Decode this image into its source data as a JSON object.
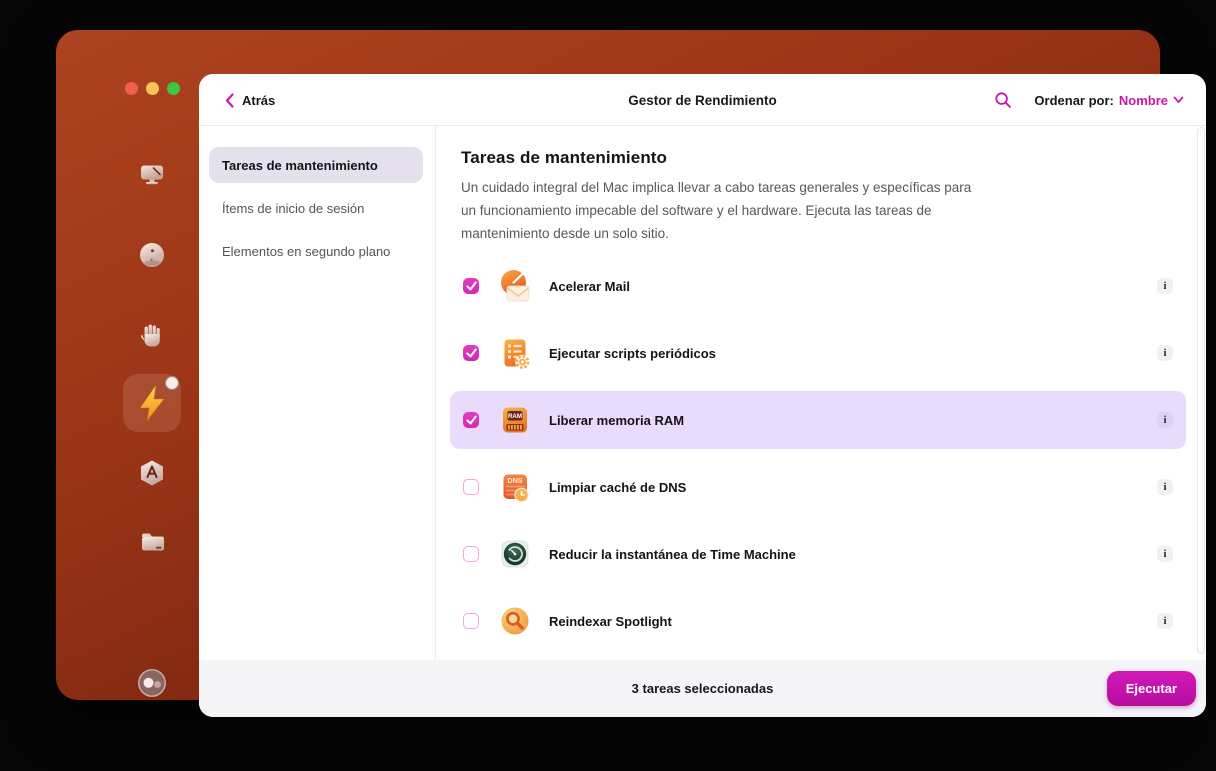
{
  "header": {
    "back_label": "Atrás",
    "title": "Gestor de Rendimiento",
    "sort_label": "Ordenar por:",
    "sort_value": "Nombre"
  },
  "rail": {
    "items": [
      {
        "name": "cleanup-monitor"
      },
      {
        "name": "protection-sphere"
      },
      {
        "name": "privacy-hand"
      },
      {
        "name": "speed-bolt",
        "selected": true,
        "badge": true
      },
      {
        "name": "applications-hexagon"
      },
      {
        "name": "files-folder"
      },
      {
        "name": "assistant"
      }
    ]
  },
  "nav": {
    "items": [
      {
        "label": "Tareas de mantenimiento",
        "selected": true
      },
      {
        "label": "Ítems de inicio de sesión",
        "selected": false
      },
      {
        "label": "Elementos en segundo plano",
        "selected": false
      }
    ]
  },
  "content": {
    "heading": "Tareas de mantenimiento",
    "description": "Un cuidado integral del Mac implica llevar a cabo tareas generales y específicas para un funcionamiento impecable del software y el hardware. Ejecuta las tareas de mantenimiento desde un solo sitio.",
    "info_label": "i",
    "tasks": [
      {
        "label": "Acelerar Mail",
        "checked": true,
        "icon": "mail-speed"
      },
      {
        "label": "Ejecutar scripts periódicos",
        "checked": true,
        "icon": "periodic-scripts"
      },
      {
        "label": "Liberar memoria RAM",
        "checked": true,
        "icon": "ram",
        "highlighted": true
      },
      {
        "label": "Limpiar caché de DNS",
        "checked": false,
        "icon": "dns-cache"
      },
      {
        "label": "Reducir la instantánea de Time Machine",
        "checked": false,
        "icon": "time-machine"
      },
      {
        "label": "Reindexar Spotlight",
        "checked": false,
        "icon": "spotlight"
      }
    ],
    "icon_text": {
      "ram": "RAM",
      "dns": "DNS"
    }
  },
  "footer": {
    "status": "3 tareas seleccionadas",
    "run_label": "Ejecutar"
  },
  "colors": {
    "accent": "#cc16a9",
    "checkbox": "#d429b2",
    "row_highlight": "#e9dbfb",
    "nav_selected": "#e4e0ed",
    "button": "#c413ac",
    "footer_bg": "#f5f4f7"
  }
}
